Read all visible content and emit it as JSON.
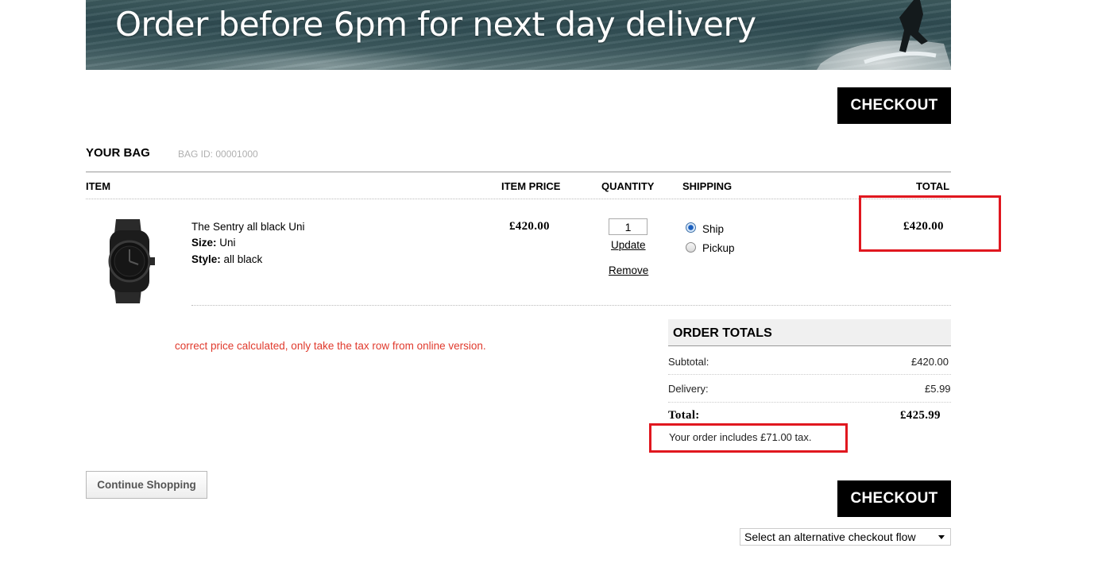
{
  "banner": {
    "text": "Order before 6pm for next day delivery"
  },
  "checkout_label": "CHECKOUT",
  "bag": {
    "title": "YOUR BAG",
    "id_text": "BAG ID: 00001000"
  },
  "columns": {
    "item": "ITEM",
    "price": "ITEM PRICE",
    "quantity": "QUANTITY",
    "shipping": "SHIPPING",
    "total": "TOTAL"
  },
  "item": {
    "name": "The Sentry all black Uni",
    "size_label": "Size:",
    "size_value": " Uni",
    "style_label": "Style:",
    "style_value": " all black",
    "price": "£420.00",
    "quantity": "1",
    "update_label": "Update",
    "remove_label": "Remove",
    "ship_label": "Ship",
    "pickup_label": "Pickup",
    "shipping_selected": "Ship",
    "total": "£420.00"
  },
  "note": "correct price calculated, only take the tax row from online version.",
  "order_totals": {
    "title": "ORDER TOTALS",
    "subtotal_label": "Subtotal:",
    "subtotal": "£420.00",
    "delivery_label": "Delivery:",
    "delivery": "£5.99",
    "total_label": "Total:",
    "total": "£425.99",
    "tax_text": "Your order includes £71.00 tax."
  },
  "continue_label": "Continue Shopping",
  "alt_checkout": {
    "selected": "Select an alternative checkout flow"
  },
  "colors": {
    "highlight": "#e0171f",
    "note": "#e03a2d",
    "button": "#000000"
  }
}
